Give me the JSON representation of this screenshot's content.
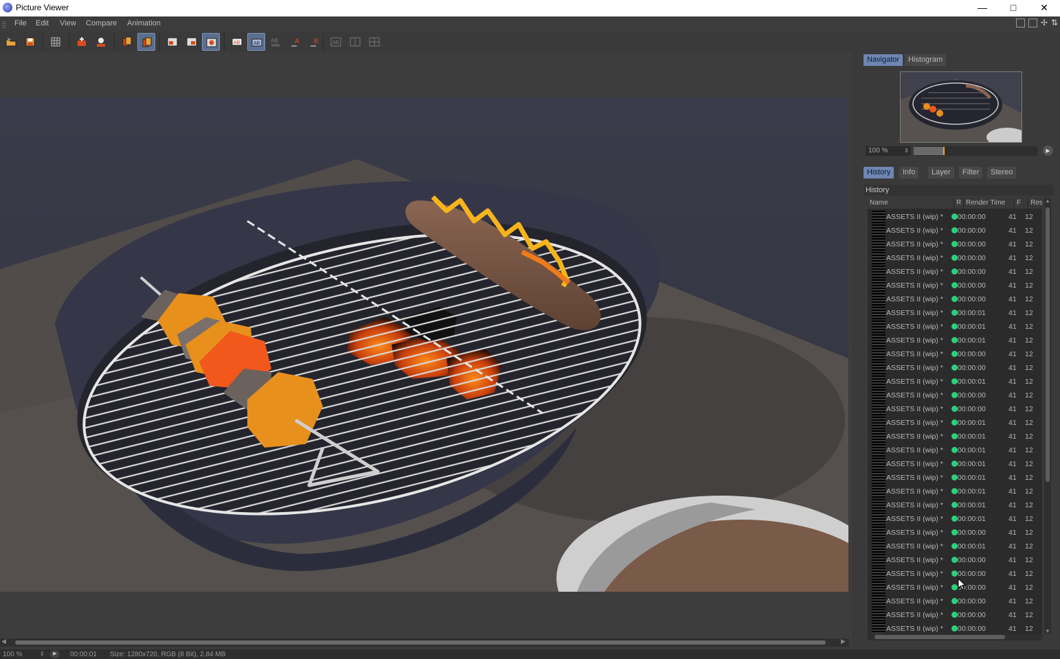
{
  "window": {
    "title": "Picture Viewer",
    "controls": [
      "minimize",
      "maximize",
      "close"
    ]
  },
  "menu": [
    "File",
    "Edit",
    "View",
    "Compare",
    "Animation"
  ],
  "toolbar": {
    "groups": [
      [
        "open-icon",
        "save-icon"
      ],
      [
        "grid-icon"
      ],
      [
        "region-icon",
        "stamp-icon"
      ],
      [
        "copy-icon",
        "copy-selected-icon"
      ],
      [
        "frame-icon",
        "frame-alt-icon",
        "eye-icon"
      ],
      [
        "ab-icon",
        "ab-selected-icon",
        "ab-dim-icon",
        "set-a-icon",
        "set-b-icon"
      ],
      [
        "layout-1-icon",
        "layout-2-icon",
        "layout-3-icon"
      ]
    ]
  },
  "navigator": {
    "tabs": [
      "Navigator",
      "Histogram"
    ],
    "zoom": "100 %",
    "zoom_fraction": 0.24
  },
  "panel_tabs": [
    "History",
    "Info",
    "Layer",
    "Filter",
    "Stereo"
  ],
  "history": {
    "title": "History",
    "columns": [
      "Name",
      "R",
      "Render Time",
      "F",
      "Res"
    ],
    "rows": [
      {
        "name": "ASSETS II (wip) *",
        "time": "00:00:00",
        "f": "41",
        "res": "12"
      },
      {
        "name": "ASSETS II (wip) *",
        "time": "00:00:00",
        "f": "41",
        "res": "12"
      },
      {
        "name": "ASSETS II (wip) *",
        "time": "00:00:00",
        "f": "41",
        "res": "12"
      },
      {
        "name": "ASSETS II (wip) *",
        "time": "00:00:00",
        "f": "41",
        "res": "12"
      },
      {
        "name": "ASSETS II (wip) *",
        "time": "00:00:00",
        "f": "41",
        "res": "12"
      },
      {
        "name": "ASSETS II (wip) *",
        "time": "00:00:00",
        "f": "41",
        "res": "12"
      },
      {
        "name": "ASSETS II (wip) *",
        "time": "00:00:00",
        "f": "41",
        "res": "12"
      },
      {
        "name": "ASSETS II (wip) *",
        "time": "00:00:01",
        "f": "41",
        "res": "12"
      },
      {
        "name": "ASSETS II (wip) *",
        "time": "00:00:01",
        "f": "41",
        "res": "12"
      },
      {
        "name": "ASSETS II (wip) *",
        "time": "00:00:01",
        "f": "41",
        "res": "12"
      },
      {
        "name": "ASSETS II (wip) *",
        "time": "00:00:00",
        "f": "41",
        "res": "12"
      },
      {
        "name": "ASSETS II (wip) *",
        "time": "00:00:00",
        "f": "41",
        "res": "12"
      },
      {
        "name": "ASSETS II (wip) *",
        "time": "00:00:01",
        "f": "41",
        "res": "12"
      },
      {
        "name": "ASSETS II (wip) *",
        "time": "00:00:00",
        "f": "41",
        "res": "12"
      },
      {
        "name": "ASSETS II (wip) *",
        "time": "00:00:00",
        "f": "41",
        "res": "12"
      },
      {
        "name": "ASSETS II (wip) *",
        "time": "00:00:01",
        "f": "41",
        "res": "12"
      },
      {
        "name": "ASSETS II (wip) *",
        "time": "00:00:01",
        "f": "41",
        "res": "12"
      },
      {
        "name": "ASSETS II (wip) *",
        "time": "00:00:01",
        "f": "41",
        "res": "12"
      },
      {
        "name": "ASSETS II (wip) *",
        "time": "00:00:01",
        "f": "41",
        "res": "12"
      },
      {
        "name": "ASSETS II (wip) *",
        "time": "00:00:01",
        "f": "41",
        "res": "12"
      },
      {
        "name": "ASSETS II (wip) *",
        "time": "00:00:01",
        "f": "41",
        "res": "12"
      },
      {
        "name": "ASSETS II (wip) *",
        "time": "00:00:01",
        "f": "41",
        "res": "12"
      },
      {
        "name": "ASSETS II (wip) *",
        "time": "00:00:01",
        "f": "41",
        "res": "12"
      },
      {
        "name": "ASSETS II (wip) *",
        "time": "00:00:00",
        "f": "41",
        "res": "12"
      },
      {
        "name": "ASSETS II (wip) *",
        "time": "00:00:01",
        "f": "41",
        "res": "12"
      },
      {
        "name": "ASSETS II (wip) *",
        "time": "00:00:00",
        "f": "41",
        "res": "12"
      },
      {
        "name": "ASSETS II (wip) *",
        "time": "00:00:00",
        "f": "41",
        "res": "12"
      },
      {
        "name": "ASSETS II (wip) *",
        "time": "00:00:00",
        "f": "41",
        "res": "12"
      },
      {
        "name": "ASSETS II (wip) *",
        "time": "00:00:00",
        "f": "41",
        "res": "12"
      },
      {
        "name": "ASSETS II (wip) *",
        "time": "00:00:00",
        "f": "41",
        "res": "12"
      },
      {
        "name": "ASSETS II (wip) *",
        "time": "00:00:00",
        "f": "41",
        "res": "12"
      }
    ]
  },
  "status": {
    "zoom": "100 %",
    "time": "00:00:01",
    "info": "Size: 1280x720, RGB (8 Bit), 2.84 MB"
  },
  "colors": {
    "accent": "#6f86b3",
    "status_dot": "#2bd07a",
    "zoom_marker": "#e8a33b"
  }
}
